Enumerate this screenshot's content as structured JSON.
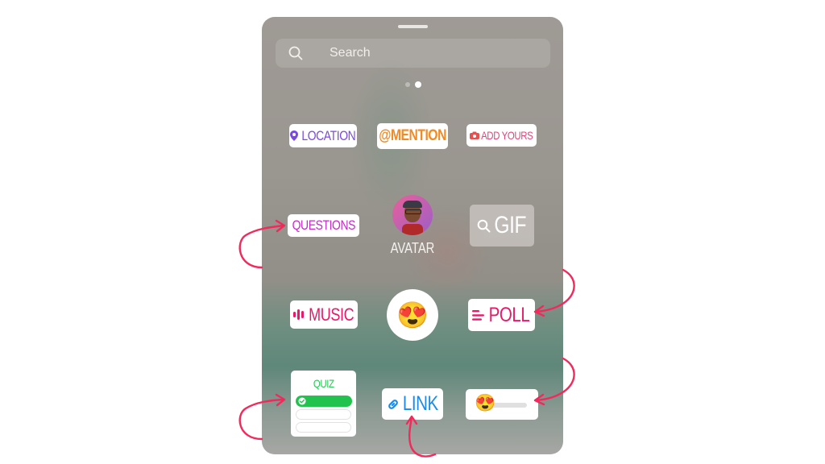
{
  "tray": {
    "search": {
      "placeholder": "Search",
      "icon": "search-icon"
    },
    "pages": {
      "count": 2,
      "active_index": 1
    }
  },
  "stickers": {
    "location": {
      "label": "LOCATION",
      "color": "#7a4ae0",
      "icon": "location-pin-icon"
    },
    "mention": {
      "label": "@MENTION",
      "color": "#f08a24",
      "icon": "at-sign-icon"
    },
    "add_yours": {
      "label": "ADD YOURS",
      "color": "#e0457a",
      "icon": "camera-icon"
    },
    "questions": {
      "label": "QUESTIONS",
      "color": "#c42bc8"
    },
    "avatar": {
      "label": "AVATAR",
      "icon": "avatar-icon"
    },
    "gif": {
      "label": "GIF",
      "icon": "search-icon"
    },
    "music": {
      "label": "MUSIC",
      "color": "#e8196a",
      "icon": "music-bars-icon"
    },
    "emoji_reaction": {
      "emoji": "😍"
    },
    "poll": {
      "label": "POLL",
      "color": "#e8196a",
      "icon": "poll-lines-icon"
    },
    "quiz": {
      "label": "QUIZ",
      "color": "#2ec45a",
      "icon": "check-icon"
    },
    "link": {
      "label": "LINK",
      "color": "#1a8be8",
      "icon": "link-icon"
    },
    "emoji_slider": {
      "emoji": "😍"
    }
  },
  "annotations": {
    "arrow_color": "#f2295b"
  }
}
